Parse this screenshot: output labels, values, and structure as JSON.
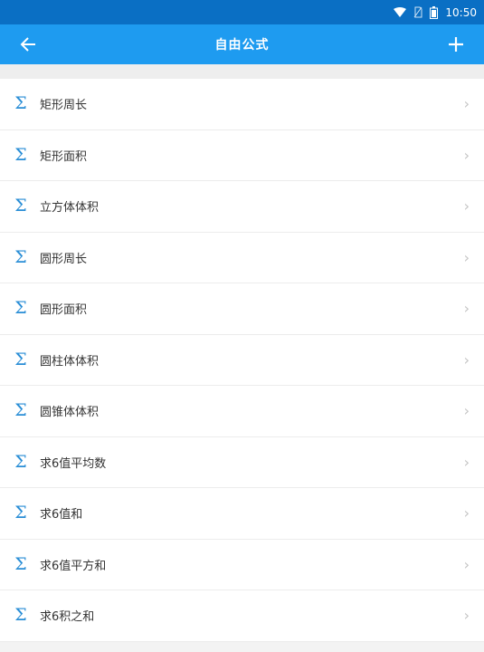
{
  "status": {
    "time": "10:50"
  },
  "appbar": {
    "title": "自由公式"
  },
  "formulas": [
    {
      "label": "矩形周长"
    },
    {
      "label": "矩形面积"
    },
    {
      "label": "立方体体积"
    },
    {
      "label": "圆形周长"
    },
    {
      "label": "圆形面积"
    },
    {
      "label": "圆柱体体积"
    },
    {
      "label": "圆锥体体积"
    },
    {
      "label": "求6值平均数"
    },
    {
      "label": "求6值和"
    },
    {
      "label": "求6值平方和"
    },
    {
      "label": "求6积之和"
    }
  ],
  "icons": {
    "item_icon": "sigma-icon",
    "item_chevron": "chevron-right-icon",
    "back": "arrow-left-icon",
    "add": "plus-icon"
  },
  "colors": {
    "status_bar": "#0a6fc4",
    "app_bar": "#1e9bf0",
    "sigma": "#2a8ed6"
  }
}
